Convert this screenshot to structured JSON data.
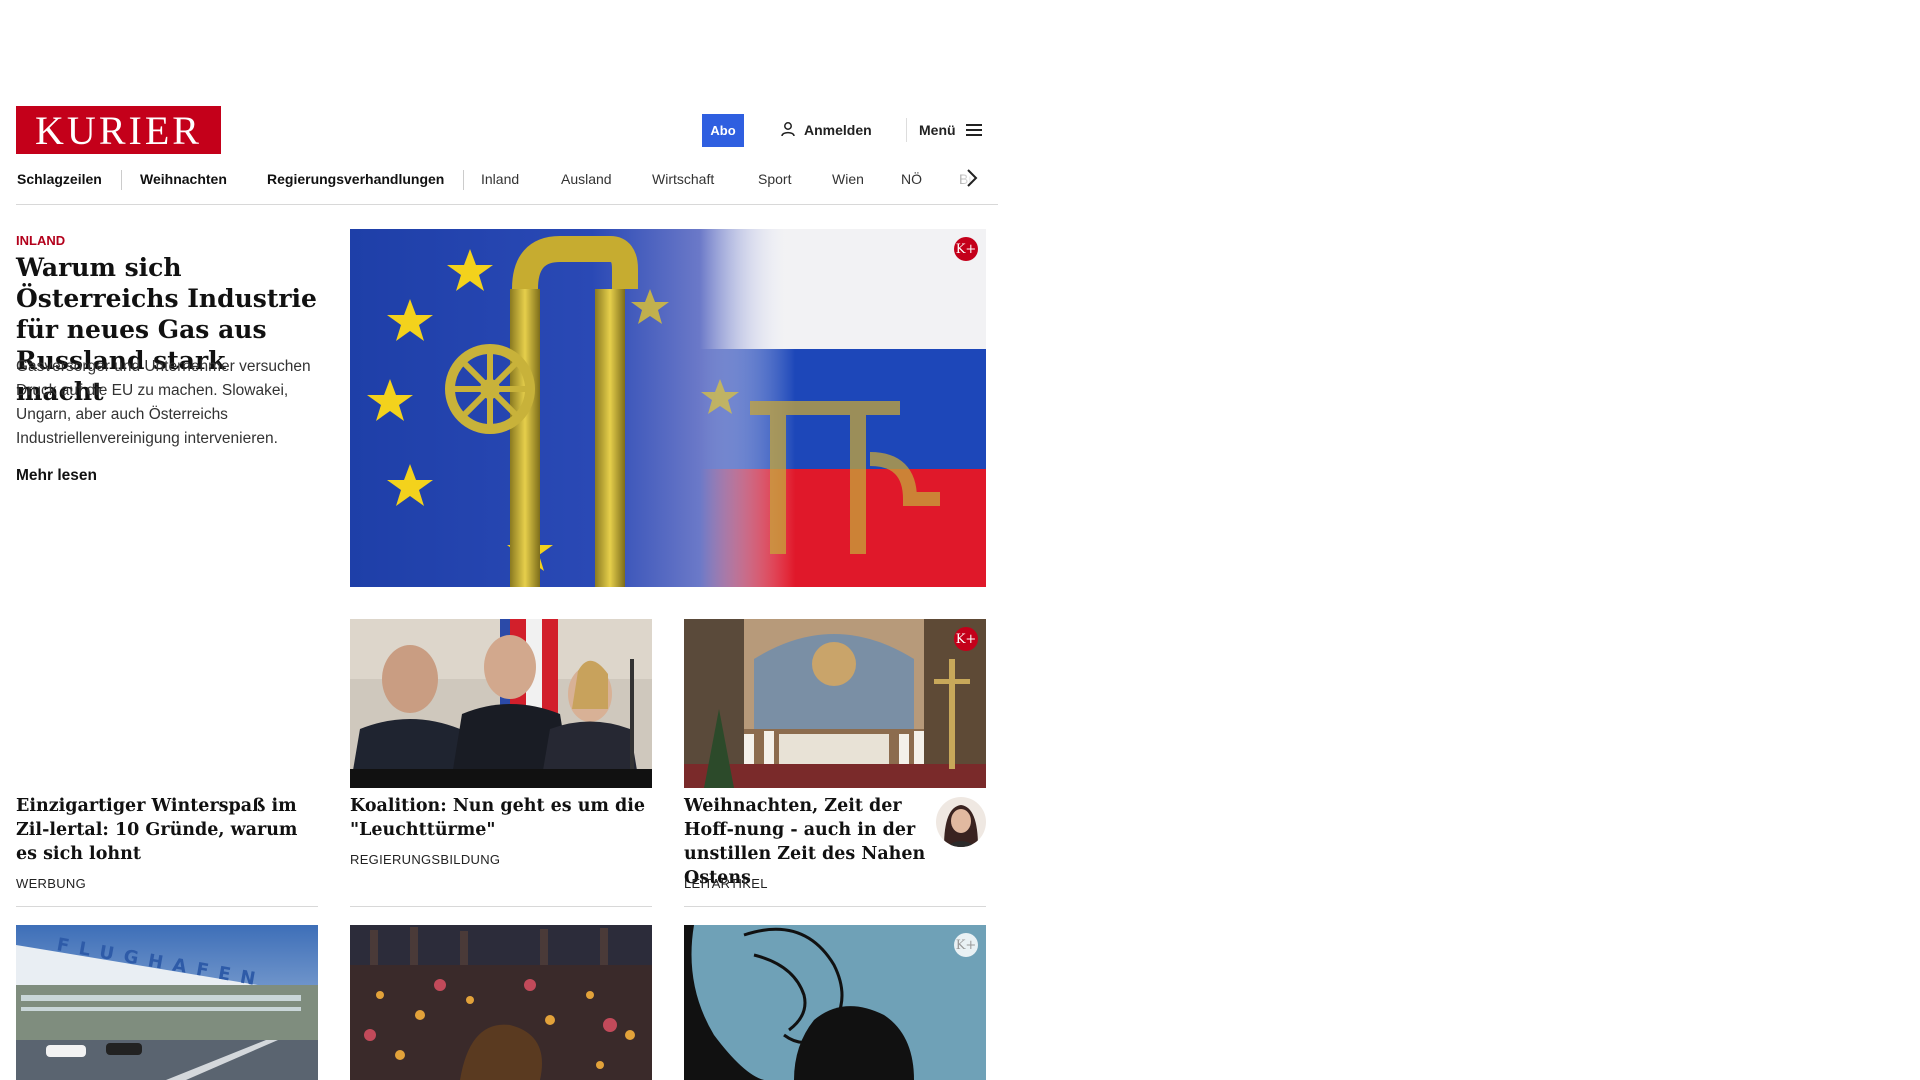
{
  "header": {
    "logo_text": "KURIER",
    "abo_label": "Abo",
    "login_label": "Anmelden",
    "menu_label": "Menü"
  },
  "nav": {
    "items": [
      "Schlagzeilen",
      "Weihnachten",
      "Regierungsverhandlungen",
      "Inland",
      "Ausland",
      "Wirtschaft",
      "Sport",
      "Wien",
      "NÖ",
      "Bu"
    ]
  },
  "lead": {
    "kicker": "INLAND",
    "title": "Warum sich Österreichs Industrie für neues Gas aus Russland stark macht",
    "text": "Gasversorger und Unternehmer versuchen Druck auf die EU zu machen. Slowakei, Ungarn, aber auch Österreichs Industriellenvereinigung intervenieren.",
    "more": "Mehr lesen",
    "badge": "K+"
  },
  "cards": [
    {
      "title": "Einzigartiger Winterspaß im Zil-lertal: 10 Gründe, warum es sich lohnt",
      "label": "WERBUNG"
    },
    {
      "title": "Koalition: Nun geht es um die \"Leuchttürme\"",
      "label": "REGIERUNGSBILDUNG"
    },
    {
      "title": "Weihnachten, Zeit der Hoff-nung - auch in der unstillen Zeit des Nahen Ostens",
      "label": "LEITARTIKEL",
      "badge": "K+"
    }
  ],
  "bottom": {
    "airport_sign": "FLUGHAFEN",
    "badge": "K+"
  },
  "colors": {
    "brand_red": "#c4001a",
    "abo_blue": "#2f5fe0",
    "kicker_red": "#b3001b"
  }
}
